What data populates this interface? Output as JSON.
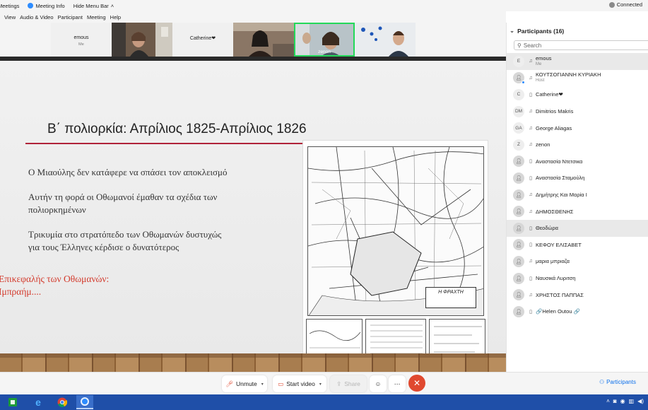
{
  "titlebar": {
    "items": [
      "Meetings",
      "Meeting Info",
      "Hide Menu Bar"
    ],
    "connection": "Connected"
  },
  "menubar": {
    "items": [
      "View",
      "Audio & Video",
      "Participant",
      "Meeting",
      "Help"
    ]
  },
  "gallery": {
    "tiles": [
      {
        "name": "emous",
        "sub": "Me"
      },
      {
        "name": "Catherine❤"
      },
      {
        "name": "zenon"
      }
    ]
  },
  "slide": {
    "title": "Β΄ πολιορκία: Απρίλιος 1825-Απρίλιος 1826",
    "p1": "Ο Μιαούλης δεν κατάφερε να σπάσει τον αποκλεισμό",
    "p2a": "Αυτήν τη φορά οι Οθωμανοί έμαθαν τα σχέδια των",
    "p2b": "πολιορκημένων",
    "p3a": "Τρικυμία στο στρατόπεδο των Οθωμανών    δυστυχώς",
    "p3b": "για τους Έλληνες κέρδισε ο δυνατότερος",
    "red1": "Επικεφαλής των Οθωμανών:",
    "red2": "Ιμπραήμ....",
    "map_title": "Η ΦΡΑΧΤΗ"
  },
  "toolbar": {
    "unmute": "Unmute",
    "start_video": "Start video",
    "share": "Share",
    "participants": "Participants"
  },
  "participants_panel": {
    "header": "Participants (16)",
    "search_placeholder": "Search",
    "people": [
      {
        "initial": "E",
        "name": "emous",
        "role": "Me",
        "device": "audio",
        "highlight": true
      },
      {
        "initial": "",
        "name": "ΚΟΥΤΣΟΓΙΑΝΝΗ ΚΥΡΙΑΚΗ",
        "role": "Host",
        "device": "audio",
        "host": true
      },
      {
        "initial": "C",
        "name": "Catherine❤",
        "device": "phone"
      },
      {
        "initial": "DM",
        "name": "Dimitrios Makris",
        "device": "audio"
      },
      {
        "initial": "GA",
        "name": "George Aliagas",
        "device": "audio"
      },
      {
        "initial": "Z",
        "name": "zenon",
        "device": "audio"
      },
      {
        "initial": "",
        "name": "Αναστασία Ντετσικα",
        "device": "phone"
      },
      {
        "initial": "",
        "name": "Αναστασία Σταμούλη",
        "device": "phone"
      },
      {
        "initial": "",
        "name": "Δημήτρης Και Μαρία Ι",
        "device": "audio"
      },
      {
        "initial": "",
        "name": "ΔΗΜΟΣΘΕΝΗΣ",
        "device": "audio"
      },
      {
        "initial": "",
        "name": "Θεοδώρα",
        "device": "phone",
        "highlight": true
      },
      {
        "initial": "",
        "name": "ΚΕΦΟΥ ΕΛΙΣΑΒΕΤ",
        "device": "phone"
      },
      {
        "initial": "",
        "name": "μαρια μπριαζα",
        "device": "audio"
      },
      {
        "initial": "",
        "name": "Ναυσικά Λυριτση",
        "device": "phone"
      },
      {
        "initial": "",
        "name": "ΧΡΗΣΤΟΣ ΠΑΠΠΑΣ",
        "device": "audio"
      },
      {
        "initial": "",
        "name": "🔗Helen Outou 🔗",
        "device": "phone"
      }
    ]
  },
  "colors": {
    "accent": "#0e71eb",
    "end_call": "#e0492f",
    "slide_rule": "#b0233a",
    "slide_red_text": "#d33a2c",
    "taskbar": "#1f4fa8"
  }
}
